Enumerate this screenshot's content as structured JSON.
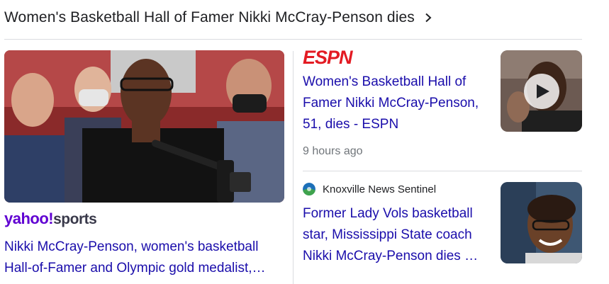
{
  "header": {
    "title": "Women's Basketball Hall of Famer Nikki McCray-Penson dies",
    "chevron_icon": "chevron-right-icon"
  },
  "lead_story": {
    "source_logo": {
      "primary": "yahoo!",
      "secondary": "sports"
    },
    "headline": "Nikki McCray-Penson, women's basketball Hall-of-Famer and Olympic gold medalist,…"
  },
  "stories": [
    {
      "source_logo": "ESPN",
      "headline": "Women's Basketball Hall of Famer Nikki McCray-Penson, 51, dies - ESPN",
      "time": "9 hours ago",
      "thumbnail_has_video": true
    },
    {
      "source_name": "Knoxville News Sentinel",
      "headline": "Former Lady Vols basketball star, Mississippi State coach Nikki McCray-Penson dies …"
    }
  ],
  "colors": {
    "link": "#1a0dab",
    "meta": "#70757a",
    "espn_red": "#e31b23",
    "yahoo_purple": "#6001d2",
    "divider": "#dadce0"
  }
}
